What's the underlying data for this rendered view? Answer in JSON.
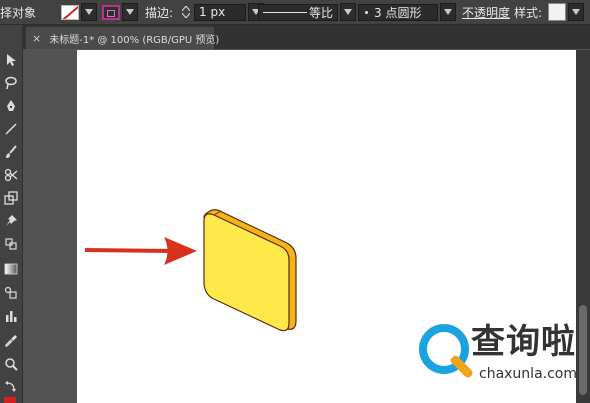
{
  "control_bar": {
    "select_object_label": "择对象",
    "stroke_label": "描边:",
    "stroke_weight": "1 px",
    "profile_label": "等比",
    "brush_label": "3 点圆形",
    "opacity_label": "不透明度",
    "style_label": "样式:"
  },
  "document_tab": {
    "close_glyph": "×",
    "title": "未标题-1* @ 100% (RGB/GPU 预览)"
  },
  "watermark": {
    "name": "查询啦",
    "url": "chaxunla.com"
  },
  "colors": {
    "arrow": "#d8321e",
    "shape_front": "#ffe84a",
    "shape_side": "#f2b416",
    "accent": "#c02f8c"
  },
  "icons": [
    "selection-tool-icon",
    "lasso-tool-icon",
    "pen-tool-icon",
    "line-tool-icon",
    "brush-tool-icon",
    "scissors-tool-icon",
    "scale-tool-icon",
    "pin-tool-icon",
    "graph-tool-icon",
    "gradient-tool-icon",
    "blend-tool-icon",
    "bar-graph-tool-icon",
    "eyedropper-tool-icon",
    "zoom-tool-icon",
    "swap-icon"
  ]
}
